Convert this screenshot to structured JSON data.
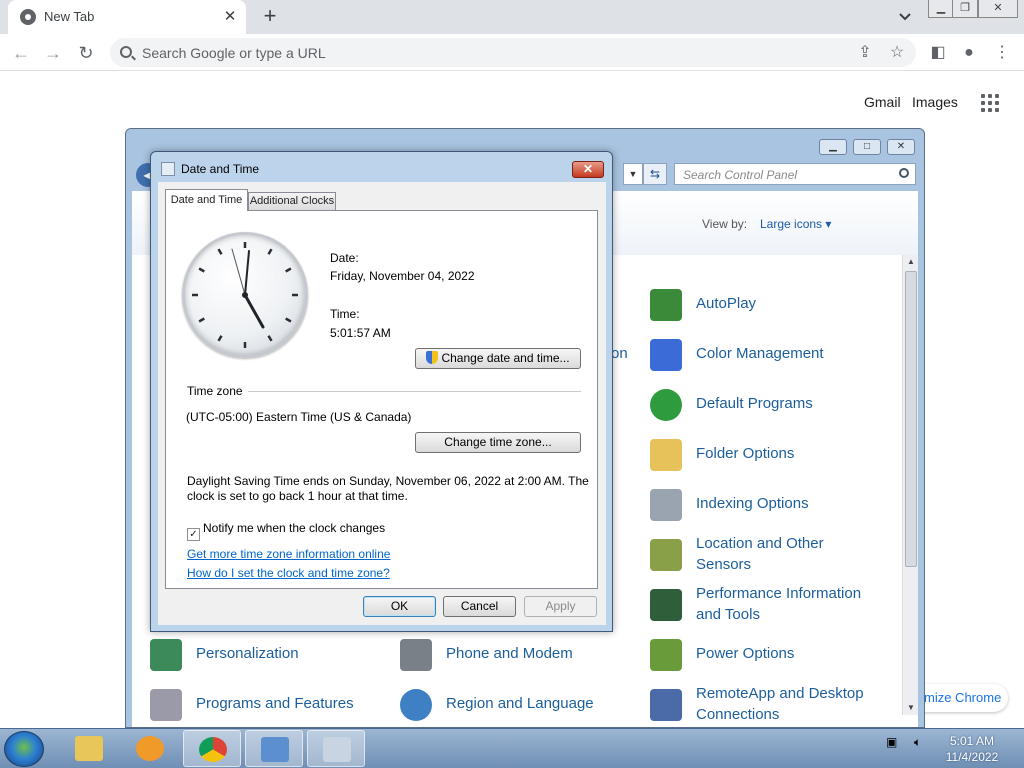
{
  "browser": {
    "tab_title": "New Tab",
    "tab_close": "✕",
    "new_tab": "+",
    "omnibox_placeholder": "Search Google or type a URL",
    "gmail": "Gmail",
    "images": "Images",
    "customize": "mize Chrome"
  },
  "control_panel": {
    "search_placeholder": "Search Control Panel",
    "view_by_label": "View by:",
    "view_by_value": "Large icons ▾",
    "partial_item": "on",
    "items_right": [
      {
        "label": "AutoPlay",
        "color": "#3a8a3a"
      },
      {
        "label": "Color Management",
        "color": "#3b6bd6"
      },
      {
        "label": "Default Programs",
        "color": "#2e9b3e"
      },
      {
        "label": "Folder Options",
        "color": "#e7c15a"
      },
      {
        "label": "Indexing Options",
        "color": "#9aa4b0"
      },
      {
        "label": "Location and Other Sensors",
        "color": "#8aa048"
      },
      {
        "label": "Performance Information and Tools",
        "color": "#2f5e3a"
      },
      {
        "label": "Power Options",
        "color": "#6a9b3a"
      },
      {
        "label": "RemoteApp and Desktop Connections",
        "color": "#4a6aa8"
      }
    ],
    "items_bottom": [
      {
        "label": "Personalization",
        "color": "#3c8a5a"
      },
      {
        "label": "Programs and Features",
        "color": "#9a9aa8"
      },
      {
        "label": "Phone and Modem",
        "color": "#7a8088"
      },
      {
        "label": "Region and Language",
        "color": "#3f7fc4"
      }
    ]
  },
  "dialog": {
    "title": "Date and Time",
    "close": "✕",
    "tabs": [
      "Date and Time",
      "Additional Clocks"
    ],
    "date_label": "Date:",
    "date_value": "Friday, November 04, 2022",
    "time_label": "Time:",
    "time_value": "5:01:57 AM",
    "change_date_btn": "Change date and time...",
    "time_zone_heading": "Time zone",
    "time_zone_value": "(UTC-05:00) Eastern Time (US & Canada)",
    "change_tz_btn": "Change time zone...",
    "dst_line1": "Daylight Saving Time ends on Sunday, November 06, 2022 at 2:00 AM. The",
    "dst_line2": "clock is set to go back 1 hour at that time.",
    "notify_label": "Notify me when the clock changes",
    "notify_checked": true,
    "link_tz_info": "Get more time zone information online",
    "link_how": "How do I set the clock and time zone?",
    "ok": "OK",
    "cancel": "Cancel",
    "apply": "Apply"
  },
  "taskbar": {
    "time": "5:01 AM",
    "date": "11/4/2022"
  }
}
